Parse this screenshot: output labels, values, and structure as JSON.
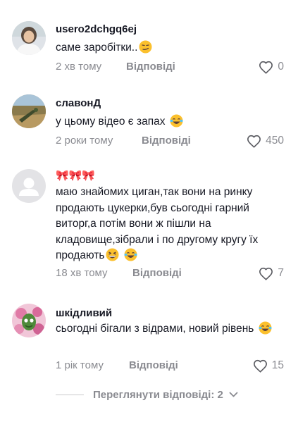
{
  "comments": [
    {
      "username": "usero2dchgq6ej",
      "text": "саме заробітки..",
      "emoji": "smirk",
      "time": "2 хв тому",
      "reply_label": "Відповіді",
      "likes": "0",
      "avatar": "user-photo"
    },
    {
      "username": "славонД",
      "text": "у цьому відео є запах",
      "emoji": "laughing-tears",
      "time": "2 роки тому",
      "reply_label": "Відповіді",
      "likes": "450",
      "avatar": "landscape-photo"
    },
    {
      "username": "🎀🎀🎀",
      "text": "маю знайомих циган,так вони на ринку продають цукерки,був сьогодні гарний виторг,а потім вони ж пішли на кладовище,зібрали і по другому кругу їх продають",
      "emoji": "grinning-laughing",
      "time": "18 хв тому",
      "reply_label": "Відповіді",
      "likes": "7",
      "avatar": "default-avatar"
    },
    {
      "username": "шкідливий",
      "text": "сьогодні бігали з відрами, новий рівень",
      "emoji": "laughing-tears",
      "time": "1 рік тому",
      "reply_label": "Відповіді",
      "likes": "15",
      "avatar": "flower-photo"
    }
  ],
  "view_replies": {
    "label": "Переглянути відповіді: 2",
    "icon": "chevron-down-icon"
  },
  "colors": {
    "text": "#161823",
    "secondary": "#8a8b91",
    "emoji_yellow": "#fbc02d"
  }
}
